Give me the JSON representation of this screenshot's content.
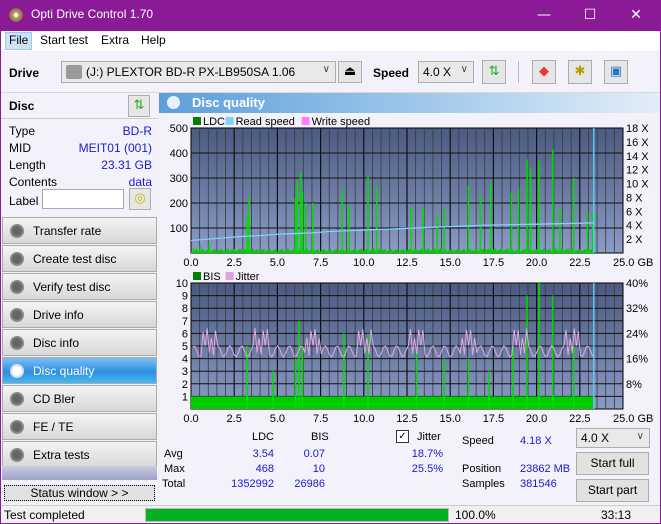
{
  "window": {
    "title": "Opti Drive Control 1.70",
    "minimize": "—",
    "maximize": "☐",
    "close": "✕"
  },
  "menu": [
    {
      "label": "File"
    },
    {
      "label": "Start test"
    },
    {
      "label": "Extra"
    },
    {
      "label": "Help"
    }
  ],
  "toolbar": {
    "drive_label": "Drive",
    "drive_value": "(J:)  PLEXTOR BD-R  PX-LB950SA 1.06",
    "speed_label": "Speed",
    "speed_value": "4.0 X"
  },
  "disc": {
    "header": "Disc",
    "type_k": "Type",
    "type_v": "BD-R",
    "mid_k": "MID",
    "mid_v": "MEIT01 (001)",
    "length_k": "Length",
    "length_v": "23.31 GB",
    "contents_k": "Contents",
    "contents_v": "data",
    "label_k": "Label",
    "label_v": ""
  },
  "nav": [
    {
      "label": "Transfer rate"
    },
    {
      "label": "Create test disc"
    },
    {
      "label": "Verify test disc"
    },
    {
      "label": "Drive info"
    },
    {
      "label": "Disc info"
    },
    {
      "label": "Disc quality",
      "active": true
    },
    {
      "label": "CD Bler"
    },
    {
      "label": "FE / TE"
    },
    {
      "label": "Extra tests"
    }
  ],
  "status_window": "Status window > >",
  "panel": {
    "title": "Disc quality"
  },
  "chart_data": [
    {
      "type": "bar",
      "title": "LDC",
      "legend": [
        "LDC",
        "Read speed",
        "Write speed"
      ],
      "legend_colors": [
        "#008000",
        "#87cefa",
        "#ff80ff"
      ],
      "xlabel": "GB",
      "xlim": [
        0,
        25
      ],
      "x_ticks": [
        "0.0",
        "2.5",
        "5.0",
        "7.5",
        "10.0",
        "12.5",
        "15.0",
        "17.5",
        "20.0",
        "22.5",
        "25.0 GB"
      ],
      "ylim": [
        0,
        500
      ],
      "y_ticks": [
        "100",
        "200",
        "300",
        "400",
        "500"
      ],
      "y2lim": [
        0,
        18
      ],
      "y2_ticks": [
        "2 X",
        "4 X",
        "6 X",
        "8 X",
        "10 X",
        "12 X",
        "14 X",
        "16 X",
        "18 X"
      ],
      "ldc_peaks": [
        [
          0.1,
          20
        ],
        [
          0.5,
          30
        ],
        [
          1.0,
          40
        ],
        [
          3.2,
          150
        ],
        [
          3.3,
          225
        ],
        [
          6.0,
          220
        ],
        [
          6.1,
          290
        ],
        [
          6.3,
          325
        ],
        [
          6.4,
          245
        ],
        [
          6.6,
          200
        ],
        [
          7.0,
          200
        ],
        [
          8.7,
          255
        ],
        [
          9.1,
          190
        ],
        [
          10.2,
          305
        ],
        [
          10.7,
          265
        ],
        [
          12.7,
          180
        ],
        [
          13.4,
          180
        ],
        [
          14.2,
          150
        ],
        [
          14.6,
          180
        ],
        [
          16.0,
          270
        ],
        [
          16.7,
          230
        ],
        [
          17.3,
          285
        ],
        [
          18.5,
          240
        ],
        [
          18.9,
          255
        ],
        [
          19.4,
          375
        ],
        [
          19.6,
          340
        ],
        [
          20.1,
          370
        ],
        [
          20.9,
          415
        ],
        [
          21.3,
          180
        ],
        [
          22.1,
          300
        ],
        [
          22.9,
          160
        ],
        [
          23.2,
          165
        ]
      ],
      "read_speed": [
        [
          0,
          1.8
        ],
        [
          1,
          2.0
        ],
        [
          2,
          2.2
        ],
        [
          3,
          2.4
        ],
        [
          4,
          2.5
        ],
        [
          5,
          2.7
        ],
        [
          6,
          2.8
        ],
        [
          7,
          2.9
        ],
        [
          8,
          3.1
        ],
        [
          9,
          3.2
        ],
        [
          10,
          3.3
        ],
        [
          11,
          3.4
        ],
        [
          12,
          3.5
        ],
        [
          13,
          3.6
        ],
        [
          14,
          3.7
        ],
        [
          15,
          3.8
        ],
        [
          16,
          3.9
        ],
        [
          17,
          4.0
        ],
        [
          18,
          4.05
        ],
        [
          19,
          4.1
        ],
        [
          20,
          4.15
        ],
        [
          21,
          4.2
        ],
        [
          22,
          4.25
        ],
        [
          23.3,
          4.35
        ]
      ],
      "end_marker_gb": 23.31
    },
    {
      "type": "bar",
      "title": "BIS",
      "legend": [
        "BIS",
        "Jitter"
      ],
      "legend_colors": [
        "#008000",
        "#e0a0e0"
      ],
      "xlabel": "GB",
      "xlim": [
        0,
        25
      ],
      "x_ticks": [
        "0.0",
        "2.5",
        "5.0",
        "7.5",
        "10.0",
        "12.5",
        "15.0",
        "17.5",
        "20.0",
        "22.5",
        "25.0 GB"
      ],
      "ylim": [
        0,
        10
      ],
      "y_ticks": [
        "1",
        "2",
        "3",
        "4",
        "5",
        "6",
        "7",
        "8",
        "9",
        "10"
      ],
      "y2lim": [
        0,
        40
      ],
      "y2_ticks": [
        "8%",
        "16%",
        "24%",
        "32%",
        "40%"
      ],
      "bis_peaks": [
        [
          3.2,
          5
        ],
        [
          4.7,
          3
        ],
        [
          6.0,
          4
        ],
        [
          6.2,
          7
        ],
        [
          6.4,
          5
        ],
        [
          8.8,
          6
        ],
        [
          10.2,
          6
        ],
        [
          13.0,
          5
        ],
        [
          14.6,
          4
        ],
        [
          16.0,
          4
        ],
        [
          17.2,
          3
        ],
        [
          18.6,
          5
        ],
        [
          19.4,
          9
        ],
        [
          20.1,
          10
        ],
        [
          20.9,
          9
        ],
        [
          22.1,
          5
        ]
      ],
      "jitter_avg_pct": 18.7,
      "jitter_max_pct": 25.5
    }
  ],
  "stats": {
    "col_ldc": "LDC",
    "col_bis": "BIS",
    "jitter_label": "Jitter",
    "jitter_checked": true,
    "avg_label": "Avg",
    "avg_ldc": "3.54",
    "avg_bis": "0.07",
    "avg_jitter": "18.7%",
    "max_label": "Max",
    "max_ldc": "468",
    "max_bis": "10",
    "max_jitter": "25.5%",
    "total_label": "Total",
    "total_ldc": "1352992",
    "total_bis": "26986",
    "speed_label": "Speed",
    "speed_value": "4.18 X",
    "position_label": "Position",
    "position_value": "23862 MB",
    "samples_label": "Samples",
    "samples_value": "381546",
    "speed_select": "4.0 X",
    "start_full": "Start full",
    "start_part": "Start part"
  },
  "statusbar": {
    "text": "Test completed",
    "progress_pct": 100,
    "progress_label": "100.0%",
    "time": "33:13"
  }
}
